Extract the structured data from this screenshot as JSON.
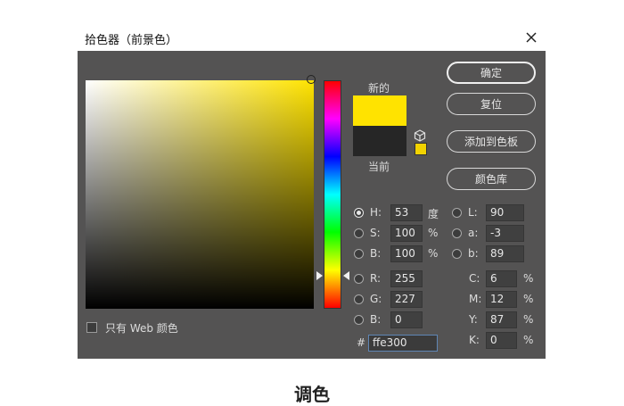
{
  "dialog": {
    "title": "拾色器（前景色）",
    "accent_color": "#ffe300"
  },
  "preview": {
    "new_label": "新的",
    "current_label": "当前",
    "new_color": "#ffe300",
    "current_color": "#262626"
  },
  "buttons": {
    "ok": "确定",
    "reset": "复位",
    "add_swatch": "添加到色板",
    "libraries": "颜色库"
  },
  "hsb": {
    "h": {
      "label": "H:",
      "value": "53",
      "unit": "度",
      "selected": true
    },
    "s": {
      "label": "S:",
      "value": "100",
      "unit": "%"
    },
    "b": {
      "label": "B:",
      "value": "100",
      "unit": "%"
    }
  },
  "lab": {
    "l": {
      "label": "L:",
      "value": "90"
    },
    "a": {
      "label": "a:",
      "value": "-3"
    },
    "b": {
      "label": "b:",
      "value": "89"
    }
  },
  "rgb": {
    "r": {
      "label": "R:",
      "value": "255"
    },
    "g": {
      "label": "G:",
      "value": "227"
    },
    "b": {
      "label": "B:",
      "value": "0"
    }
  },
  "cmyk": {
    "c": {
      "label": "C:",
      "value": "6",
      "unit": "%"
    },
    "m": {
      "label": "M:",
      "value": "12",
      "unit": "%"
    },
    "y": {
      "label": "Y:",
      "value": "87",
      "unit": "%"
    },
    "k": {
      "label": "K:",
      "value": "0",
      "unit": "%"
    }
  },
  "hex": {
    "label": "#",
    "value": "ffe300"
  },
  "web_only": {
    "label": "只有 Web 颜色",
    "checked": false
  },
  "caption": "调色"
}
